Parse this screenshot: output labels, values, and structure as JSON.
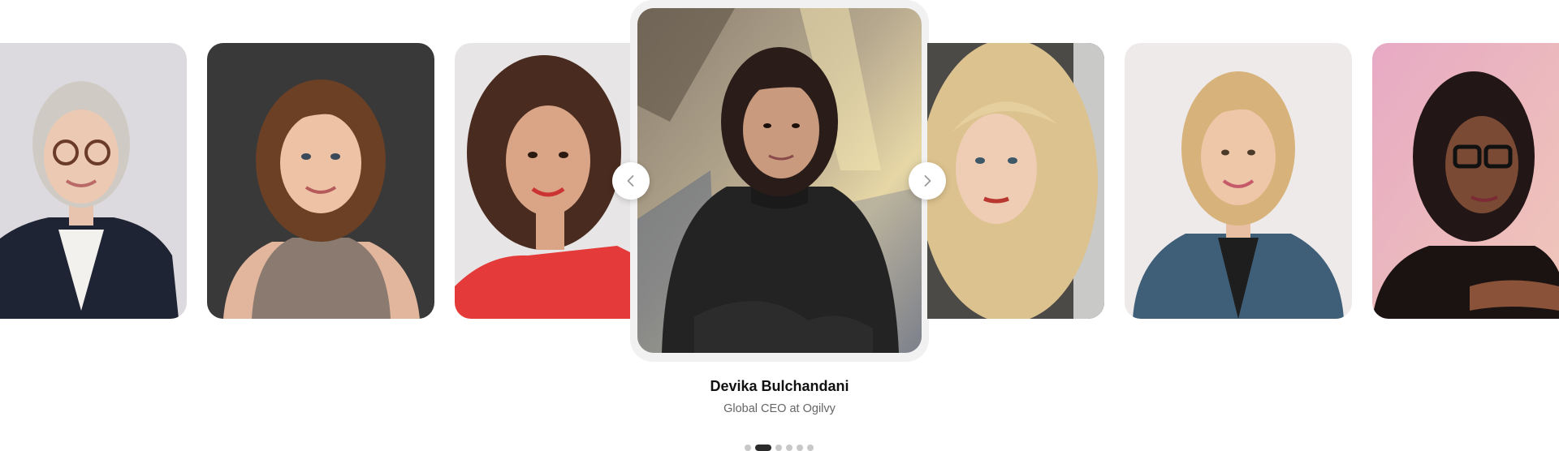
{
  "featured": {
    "name": "Devika Bulchandani",
    "role": "Global CEO at Ogilvy"
  },
  "carousel": {
    "prev_label": "Previous",
    "next_label": "Next",
    "prev_icon": "chevron-left-icon",
    "next_icon": "chevron-right-icon",
    "dot_count": 6,
    "active_dot": 2
  },
  "colors": {
    "background": "#ffffff",
    "active_dot": "#2b2b2b",
    "inactive_dot": "#c8c8c8",
    "name_text": "#111111",
    "role_text": "#666666"
  }
}
